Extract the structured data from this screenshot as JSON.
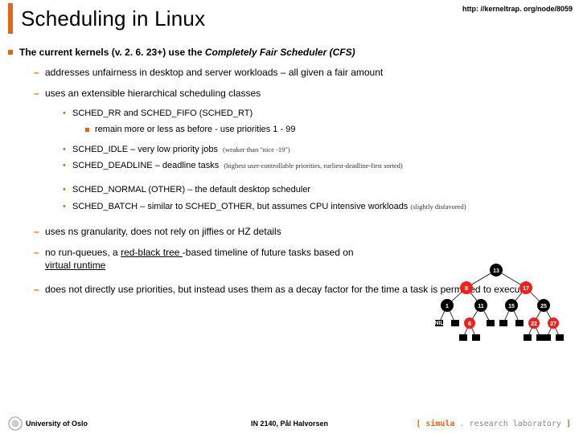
{
  "header": {
    "title": "Scheduling in Linux",
    "url": "http: //kerneltrap. org/node/8059"
  },
  "bullet1": {
    "prefix": "The current kernels (v. 2. 6. 23+) use the ",
    "emph": "Completely Fair Scheduler (CFS)"
  },
  "sub": {
    "a": "addresses unfairness in desktop and server workloads – all given a fair amount",
    "b": "uses an extensible hierarchical scheduling classes",
    "c": "uses ns granularity, does not rely on jiffies or HZ details",
    "d_pre": "no run-queues, a ",
    "d_link": "red-black tree ",
    "d_mid": "-based timeline of future tasks based on ",
    "d_vr": "virtual runtime",
    "e": "does not directly use priorities, but instead uses them as a decay factor for the time a task is permitted to execute"
  },
  "sched": {
    "rr_fifo": "SCHED_RR and SCHED_FIFO (SCHED_RT)",
    "rr_detail": "remain more or less as before - use priorities 1 - 99",
    "idle": "SCHED_IDLE – very low priority jobs",
    "idle_note": "(weaker than \"nice -19\")",
    "deadline": "SCHED_DEADLINE – deadline tasks",
    "deadline_note": "(highest user-controllable priorities, earliest-deadline-first sorted)",
    "normal": "SCHED_NORMAL (OTHER) – the default desktop scheduler",
    "batch": "SCHED_BATCH – similar to SCHED_OTHER, but assumes CPU intensive workloads",
    "batch_note": "(slightly disfavored)"
  },
  "tree": {
    "root": "13",
    "l": "8",
    "r": "17",
    "ll": "1",
    "lr": "11",
    "rl": "15",
    "rr": "25",
    "lrl": "6",
    "rrl": "22",
    "rrr": "27",
    "nil": "NIL"
  },
  "footer": {
    "uio": "University of Oslo",
    "center": "IN 2140, Pål Halvorsen",
    "simula_open": "[ ",
    "simula_brand": "simula",
    "simula_rest": " . research laboratory ",
    "simula_close": "]"
  }
}
